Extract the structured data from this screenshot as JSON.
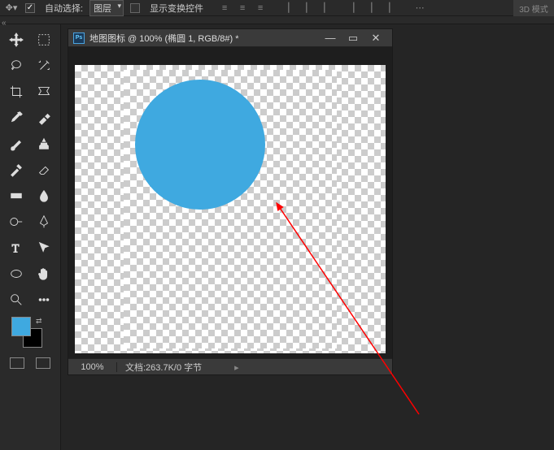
{
  "toolbar": {
    "auto_select_label": "自动选择:",
    "layer_select": "图层",
    "show_transform_label": "显示变换控件",
    "mode_3d": "3D 模式"
  },
  "document": {
    "title": "地图图标 @ 100% (椭圆 1, RGB/8#) *",
    "zoom": "100%",
    "info": "文档:263.7K/0 字节"
  },
  "colors": {
    "foreground": "#3fa9e0",
    "circle": "#3fa9e0",
    "arrow": "#ff0000"
  }
}
